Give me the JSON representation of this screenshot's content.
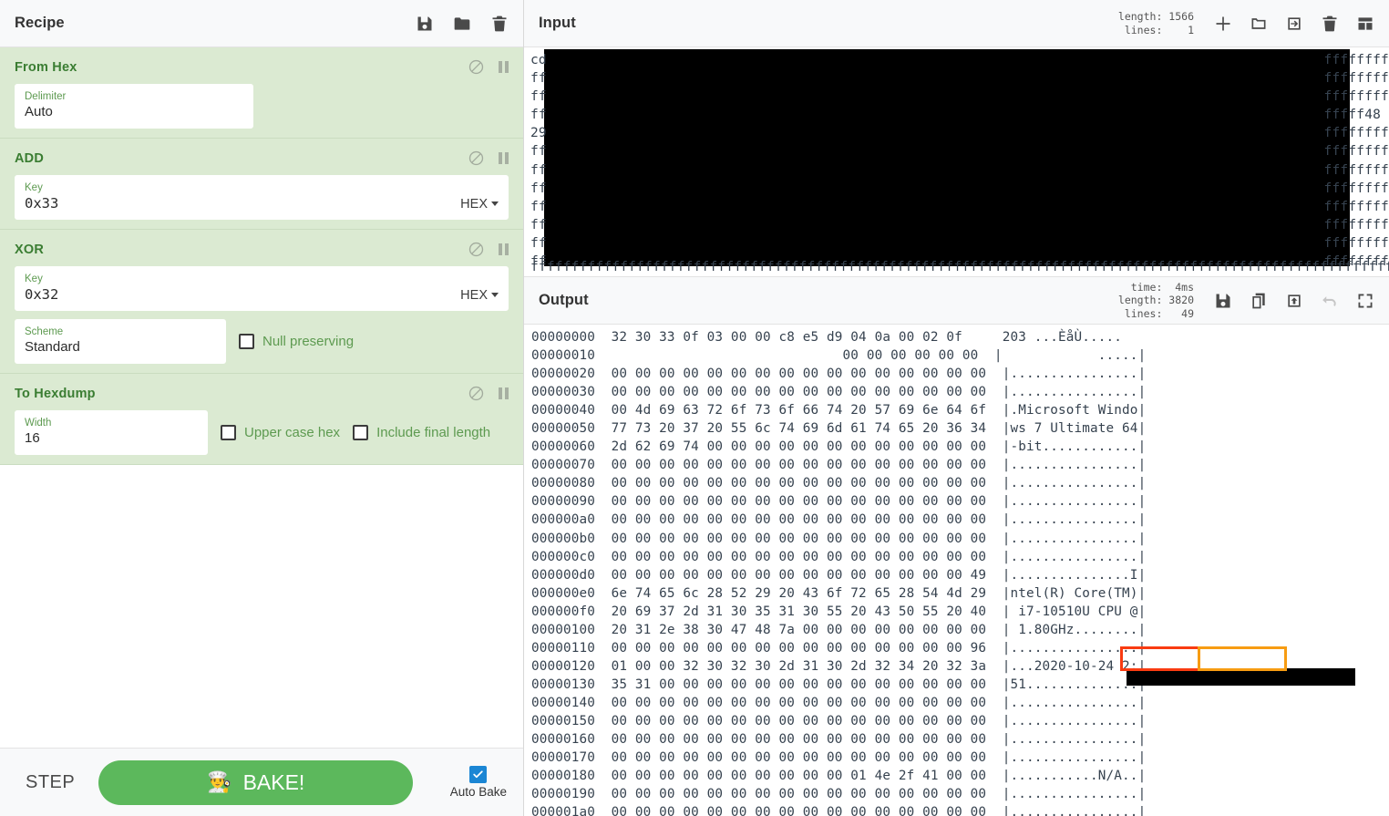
{
  "recipe": {
    "title": "Recipe",
    "icons": [
      {
        "name": "save-recipe-icon",
        "label": "Save recipe"
      },
      {
        "name": "load-recipe-icon",
        "label": "Load recipe"
      },
      {
        "name": "clear-recipe-icon",
        "label": "Clear recipe"
      }
    ],
    "operations": [
      {
        "name": "From Hex",
        "args": [
          {
            "label": "Delimiter",
            "value": "Auto"
          }
        ]
      },
      {
        "name": "ADD",
        "args": [
          {
            "label": "Key",
            "value": "0x33",
            "type_selector": "HEX"
          }
        ]
      },
      {
        "name": "XOR",
        "args": [
          {
            "label": "Key",
            "value": "0x32",
            "type_selector": "HEX"
          },
          {
            "label": "Scheme",
            "value": "Standard"
          }
        ],
        "checkboxes": [
          {
            "label": "Null preserving",
            "checked": false
          }
        ]
      },
      {
        "name": "To Hexdump",
        "args": [
          {
            "label": "Width",
            "value": "16"
          }
        ],
        "checkboxes": [
          {
            "label": "Upper case hex",
            "checked": false
          },
          {
            "label": "Include final length",
            "checked": false
          }
        ]
      }
    ],
    "footer": {
      "step_label": "STEP",
      "bake_label": "BAKE!",
      "bake_emoji": "👨‍🍳",
      "auto_bake_label": "Auto Bake",
      "auto_bake_checked": true,
      "bake_color": "#5cb85c"
    }
  },
  "input": {
    "title": "Input",
    "stats": "length: 1566\n lines:    1",
    "length_label": "length:",
    "length_value": "1566",
    "lines_label": "lines:",
    "lines_value": "1",
    "icons": [
      {
        "name": "add-input-tab-icon"
      },
      {
        "name": "open-folder-icon"
      },
      {
        "name": "open-file-as-input-icon"
      },
      {
        "name": "clear-input-icon"
      },
      {
        "name": "reset-pane-layout-icon"
      }
    ],
    "left_column": [
      "cd",
      "ff",
      "ff",
      "ff",
      "29",
      "ff",
      "ff",
      "ff",
      "ff",
      "ff",
      "ff",
      "ff"
    ],
    "right_column": [
      "ffffffff",
      "ffffffff",
      "ffffffff",
      "fffff48",
      "ffffffff",
      "ffffffff",
      "ffffffff",
      "ffffffff",
      "ffffffff",
      "ffffffff",
      "ffffffff",
      "ffffffff"
    ],
    "scroll_row": "ffffffffffffffffffffffffffffffffffffffffffffffffffffffffffffffffffffffffffffffffffffffffffffffffffffffffffffffffffffffffffffffffffffffffffffffffffffffffff",
    "redacted": true
  },
  "output": {
    "title": "Output",
    "time_label": "time:",
    "time_value": "4ms",
    "length_label": "length:",
    "length_value": "3820",
    "lines_label": "lines:",
    "lines_value": "49",
    "stats": "  time:  4ms\nlength: 3820\n lines:   49",
    "icons": [
      {
        "name": "save-output-icon"
      },
      {
        "name": "copy-output-icon"
      },
      {
        "name": "replace-input-with-output-icon"
      },
      {
        "name": "undo-icon",
        "disabled": true
      },
      {
        "name": "maximise-output-icon"
      }
    ],
    "hexdump_lines": [
      {
        "offset": "00000000",
        "hex": "32 30 33 0f 03 00 00 c8 e5 d9 04 0a 00 02 0f   ",
        "ascii": "203 ...ÈåÙ....."
      },
      {
        "offset": "00000010",
        "hex": "                             00 00 00 00 00 00",
        "ascii": "|            .....|"
      },
      {
        "offset": "00000020",
        "hex": "00 00 00 00 00 00 00 00 00 00 00 00 00 00 00 00",
        "ascii": "|................|"
      },
      {
        "offset": "00000030",
        "hex": "00 00 00 00 00 00 00 00 00 00 00 00 00 00 00 00",
        "ascii": "|................|"
      },
      {
        "offset": "00000040",
        "hex": "00 4d 69 63 72 6f 73 6f 66 74 20 57 69 6e 64 6f",
        "ascii": "|.Microsoft Windo|"
      },
      {
        "offset": "00000050",
        "hex": "77 73 20 37 20 55 6c 74 69 6d 61 74 65 20 36 34",
        "ascii": "|ws 7 Ultimate 64|"
      },
      {
        "offset": "00000060",
        "hex": "2d 62 69 74 00 00 00 00 00 00 00 00 00 00 00 00",
        "ascii": "|-bit............|"
      },
      {
        "offset": "00000070",
        "hex": "00 00 00 00 00 00 00 00 00 00 00 00 00 00 00 00",
        "ascii": "|................|"
      },
      {
        "offset": "00000080",
        "hex": "00 00 00 00 00 00 00 00 00 00 00 00 00 00 00 00",
        "ascii": "|................|"
      },
      {
        "offset": "00000090",
        "hex": "00 00 00 00 00 00 00 00 00 00 00 00 00 00 00 00",
        "ascii": "|................|"
      },
      {
        "offset": "000000a0",
        "hex": "00 00 00 00 00 00 00 00 00 00 00 00 00 00 00 00",
        "ascii": "|................|"
      },
      {
        "offset": "000000b0",
        "hex": "00 00 00 00 00 00 00 00 00 00 00 00 00 00 00 00",
        "ascii": "|................|"
      },
      {
        "offset": "000000c0",
        "hex": "00 00 00 00 00 00 00 00 00 00 00 00 00 00 00 00",
        "ascii": "|................|"
      },
      {
        "offset": "000000d0",
        "hex": "00 00 00 00 00 00 00 00 00 00 00 00 00 00 00 49",
        "ascii": "|...............I|"
      },
      {
        "offset": "000000e0",
        "hex": "6e 74 65 6c 28 52 29 20 43 6f 72 65 28 54 4d 29",
        "ascii": "|ntel(R) Core(TM)|"
      },
      {
        "offset": "000000f0",
        "hex": "20 69 37 2d 31 30 35 31 30 55 20 43 50 55 20 40",
        "ascii": "| i7-10510U CPU @|"
      },
      {
        "offset": "00000100",
        "hex": "20 31 2e 38 30 47 48 7a 00 00 00 00 00 00 00 00",
        "ascii": "| 1.80GHz........|"
      },
      {
        "offset": "00000110",
        "hex": "00 00 00 00 00 00 00 00 00 00 00 00 00 00 00 96",
        "ascii": "|................|"
      },
      {
        "offset": "00000120",
        "hex": "01 00 00 32 30 32 30 2d 31 30 2d 32 34 20 32 3a",
        "ascii": "|...2020-10-24 2:|"
      },
      {
        "offset": "00000130",
        "hex": "35 31 00 00 00 00 00 00 00 00 00 00 00 00 00 00",
        "ascii": "|51..............|"
      },
      {
        "offset": "00000140",
        "hex": "00 00 00 00 00 00 00 00 00 00 00 00 00 00 00 00",
        "ascii": "|................|"
      },
      {
        "offset": "00000150",
        "hex": "00 00 00 00 00 00 00 00 00 00 00 00 00 00 00 00",
        "ascii": "|................|"
      },
      {
        "offset": "00000160",
        "hex": "00 00 00 00 00 00 00 00 00 00 00 00 00 00 00 00",
        "ascii": "|................|"
      },
      {
        "offset": "00000170",
        "hex": "00 00 00 00 00 00 00 00 00 00 00 00 00 00 00 00",
        "ascii": "|................|"
      },
      {
        "offset": "00000180",
        "hex": "00 00 00 00 00 00 00 00 00 00 01 4e 2f 41 00 00",
        "ascii": "|...........N/A..|"
      },
      {
        "offset": "00000190",
        "hex": "00 00 00 00 00 00 00 00 00 00 00 00 00 00 00 00",
        "ascii": "|................|"
      },
      {
        "offset": "000001a0",
        "hex": "00 00 00 00 00 00 00 00 00 00 00 00 00 00 00 00",
        "ascii": "|................|"
      }
    ],
    "highlights": [
      {
        "name": "highlight-serial-prefix",
        "color": "#f93b11",
        "shape": "rect"
      },
      {
        "name": "highlight-length-bytes",
        "color": "#f79c12",
        "shape": "rect"
      },
      {
        "name": "highlight-ascii-203",
        "color": "#f93b11",
        "shape": "rect"
      }
    ]
  },
  "colors": {
    "recipe_green": "#dbead2",
    "op_title_green": "#3a7d32",
    "bake_green": "#5cb85c",
    "highlight_red": "#f93b11",
    "highlight_orange": "#f79c12",
    "checkbox_blue": "#1b86d4"
  }
}
